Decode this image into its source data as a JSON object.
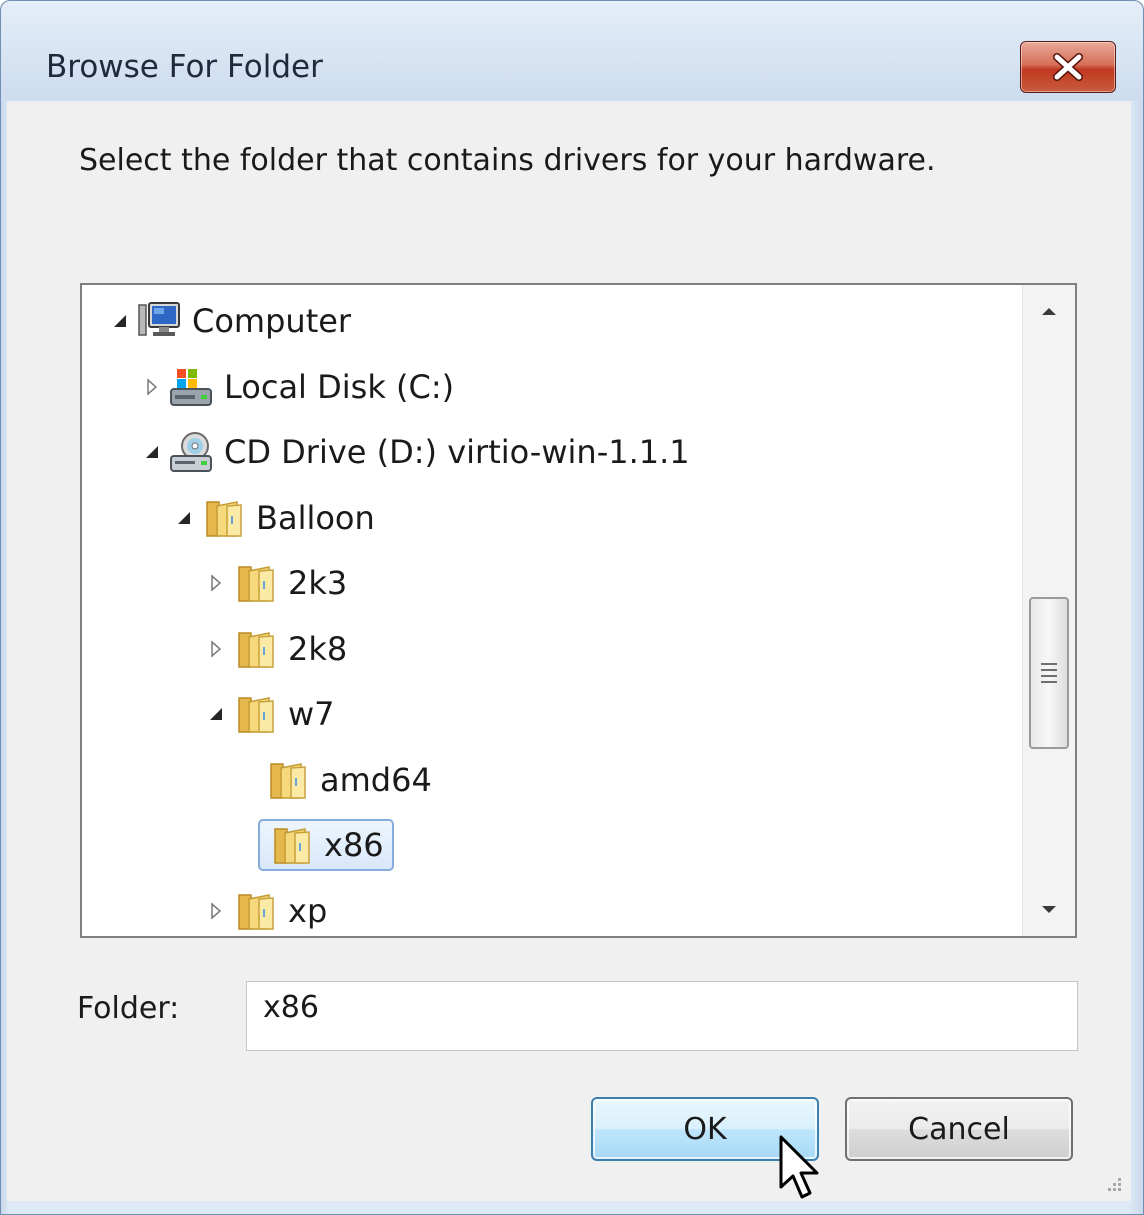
{
  "window": {
    "title": "Browse For Folder",
    "close_icon": "close-x-icon",
    "accent_close": "#c0391f",
    "frame_color": "#dde9f5"
  },
  "instruction": "Select the folder that contains drivers for your hardware.",
  "tree": {
    "items": [
      {
        "label": "Computer",
        "expander": "expanded",
        "icon": "computer-icon",
        "level": 0
      },
      {
        "label": "Local Disk (C:)",
        "expander": "collapsed",
        "icon": "local-disk-icon",
        "level": 1
      },
      {
        "label": "CD Drive (D:) virtio-win-1.1.1",
        "expander": "expanded",
        "icon": "cd-drive-icon",
        "level": 1
      },
      {
        "label": "Balloon",
        "expander": "expanded",
        "icon": "folder-icon",
        "level": 2
      },
      {
        "label": "2k3",
        "expander": "collapsed",
        "icon": "folder-icon",
        "level": 3
      },
      {
        "label": "2k8",
        "expander": "collapsed",
        "icon": "folder-icon",
        "level": 3
      },
      {
        "label": "w7",
        "expander": "expanded",
        "icon": "folder-icon",
        "level": 3
      },
      {
        "label": "amd64",
        "expander": "none",
        "icon": "folder-icon",
        "level": 4
      },
      {
        "label": "x86",
        "expander": "none",
        "icon": "folder-icon",
        "level": 4,
        "selected": true
      },
      {
        "label": "xp",
        "expander": "collapsed",
        "icon": "folder-icon",
        "level": 3
      }
    ],
    "selected_color": "#d8e8fa"
  },
  "scrollbar": {
    "up_icon": "scroll-up-arrow-icon",
    "down_icon": "scroll-down-arrow-icon"
  },
  "folder": {
    "label": "Folder:",
    "value": "x86"
  },
  "buttons": {
    "ok": "OK",
    "cancel": "Cancel"
  }
}
